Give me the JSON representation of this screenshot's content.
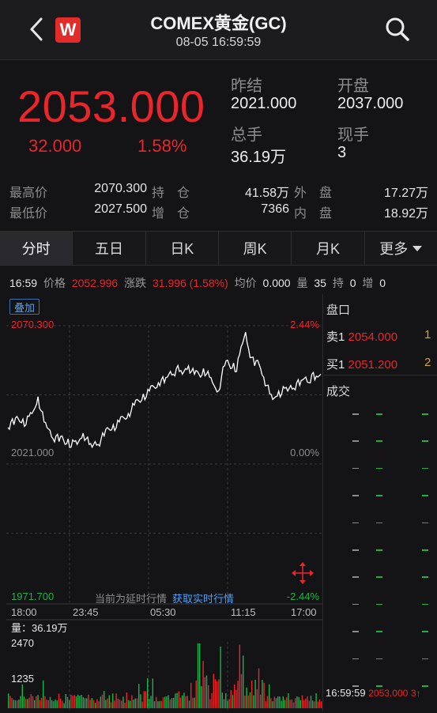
{
  "header": {
    "title": "COMEX黄金(GC)",
    "subtitle": "08-05 16:59:59",
    "logo_letter": "W"
  },
  "quote": {
    "price": "2053.000",
    "change": "32.000",
    "change_pct": "1.58%",
    "prev_close_label": "昨结",
    "prev_close": "2021.000",
    "open_label": "开盘",
    "open": "2037.000",
    "volume_label": "总手",
    "volume": "36.19万",
    "last_vol_label": "现手",
    "last_vol": "3"
  },
  "stats": {
    "high_label": "最高价",
    "high": "2070.300",
    "low_label": "最低价",
    "low": "2027.500",
    "hold_label": "持　仓",
    "hold": "41.58万",
    "inc_label": "增　仓",
    "inc": "7366",
    "outer_label": "外　盘",
    "outer": "17.27万",
    "inner_label": "内　盘",
    "inner": "18.92万"
  },
  "tabs": [
    {
      "label": "分时"
    },
    {
      "label": "五日"
    },
    {
      "label": "日K"
    },
    {
      "label": "周K"
    },
    {
      "label": "月K"
    },
    {
      "label": "更多"
    }
  ],
  "info": {
    "time": "16:59",
    "price_label": "价格",
    "price": "2052.996",
    "change_label": "涨跌",
    "change": "31.996 (1.58%)",
    "avg_label": "均价",
    "avg": "0.000",
    "vol_label": "量",
    "vol": "35",
    "hold_label": "持",
    "hold": "0",
    "inc_label": "增",
    "inc": "0"
  },
  "chart": {
    "overlay_label": "叠加",
    "y_top": "2070.300",
    "y_mid": "2021.000",
    "y_bottom": "1971.700",
    "pct_top": "2.44%",
    "pct_mid": "0.00%",
    "pct_bottom": "-2.44%",
    "delay_note": "当前为延时行情",
    "realtime_link": "获取实时行情",
    "x_ticks": [
      "18:00",
      "23:45",
      "05:30",
      "11:15",
      "17:00"
    ],
    "vol_label": "量：36.19万",
    "vol_top": "2470",
    "vol_mid": "1235",
    "up_color": "#e8262b",
    "down_color": "#19b34a",
    "line_color": "#ffffff"
  },
  "chart_data": {
    "type": "line",
    "title": "",
    "xlabel": "",
    "ylabel": "",
    "x_ticks": [
      "18:00",
      "23:45",
      "05:30",
      "11:15",
      "17:00"
    ],
    "ylim": [
      1971.7,
      2070.3
    ],
    "series": [
      {
        "values": [
          2034,
          2036,
          2035,
          2038,
          2036,
          2037,
          2035,
          2038,
          2039,
          2041,
          2045,
          2040,
          2036,
          2034,
          2033,
          2030,
          2031,
          2029,
          2031,
          2028,
          2030,
          2027,
          2029,
          2028,
          2030,
          2032,
          2030,
          2028,
          2027,
          2029,
          2028,
          2030,
          2031,
          2034,
          2033,
          2035,
          2034,
          2036,
          2038,
          2037,
          2039,
          2040,
          2042,
          2044,
          2043,
          2046,
          2045,
          2047,
          2049,
          2048,
          2050,
          2051,
          2050,
          2052,
          2054,
          2053,
          2055,
          2054,
          2053,
          2055,
          2056,
          2054,
          2053,
          2054,
          2052,
          2055,
          2053,
          2052,
          2050,
          2048,
          2047,
          2052,
          2056,
          2058,
          2055,
          2057,
          2054,
          2060,
          2064,
          2068,
          2062,
          2059,
          2056,
          2058,
          2055,
          2052,
          2049,
          2046,
          2044,
          2045,
          2047,
          2046,
          2048,
          2047,
          2049,
          2048,
          2050,
          2049,
          2051,
          2052,
          2050,
          2053,
          2051,
          2052,
          2053
        ]
      }
    ]
  },
  "order_book": {
    "title": "盘口",
    "ask_label": "卖1",
    "ask_price": "2054.000",
    "ask_vol": "1",
    "bid_label": "买1",
    "bid_price": "2051.200",
    "bid_vol": "2",
    "trades_title": "成交",
    "last_trade_time": "16:59:59",
    "last_trade_price": "2053.000",
    "last_trade_vol": "3↑"
  }
}
